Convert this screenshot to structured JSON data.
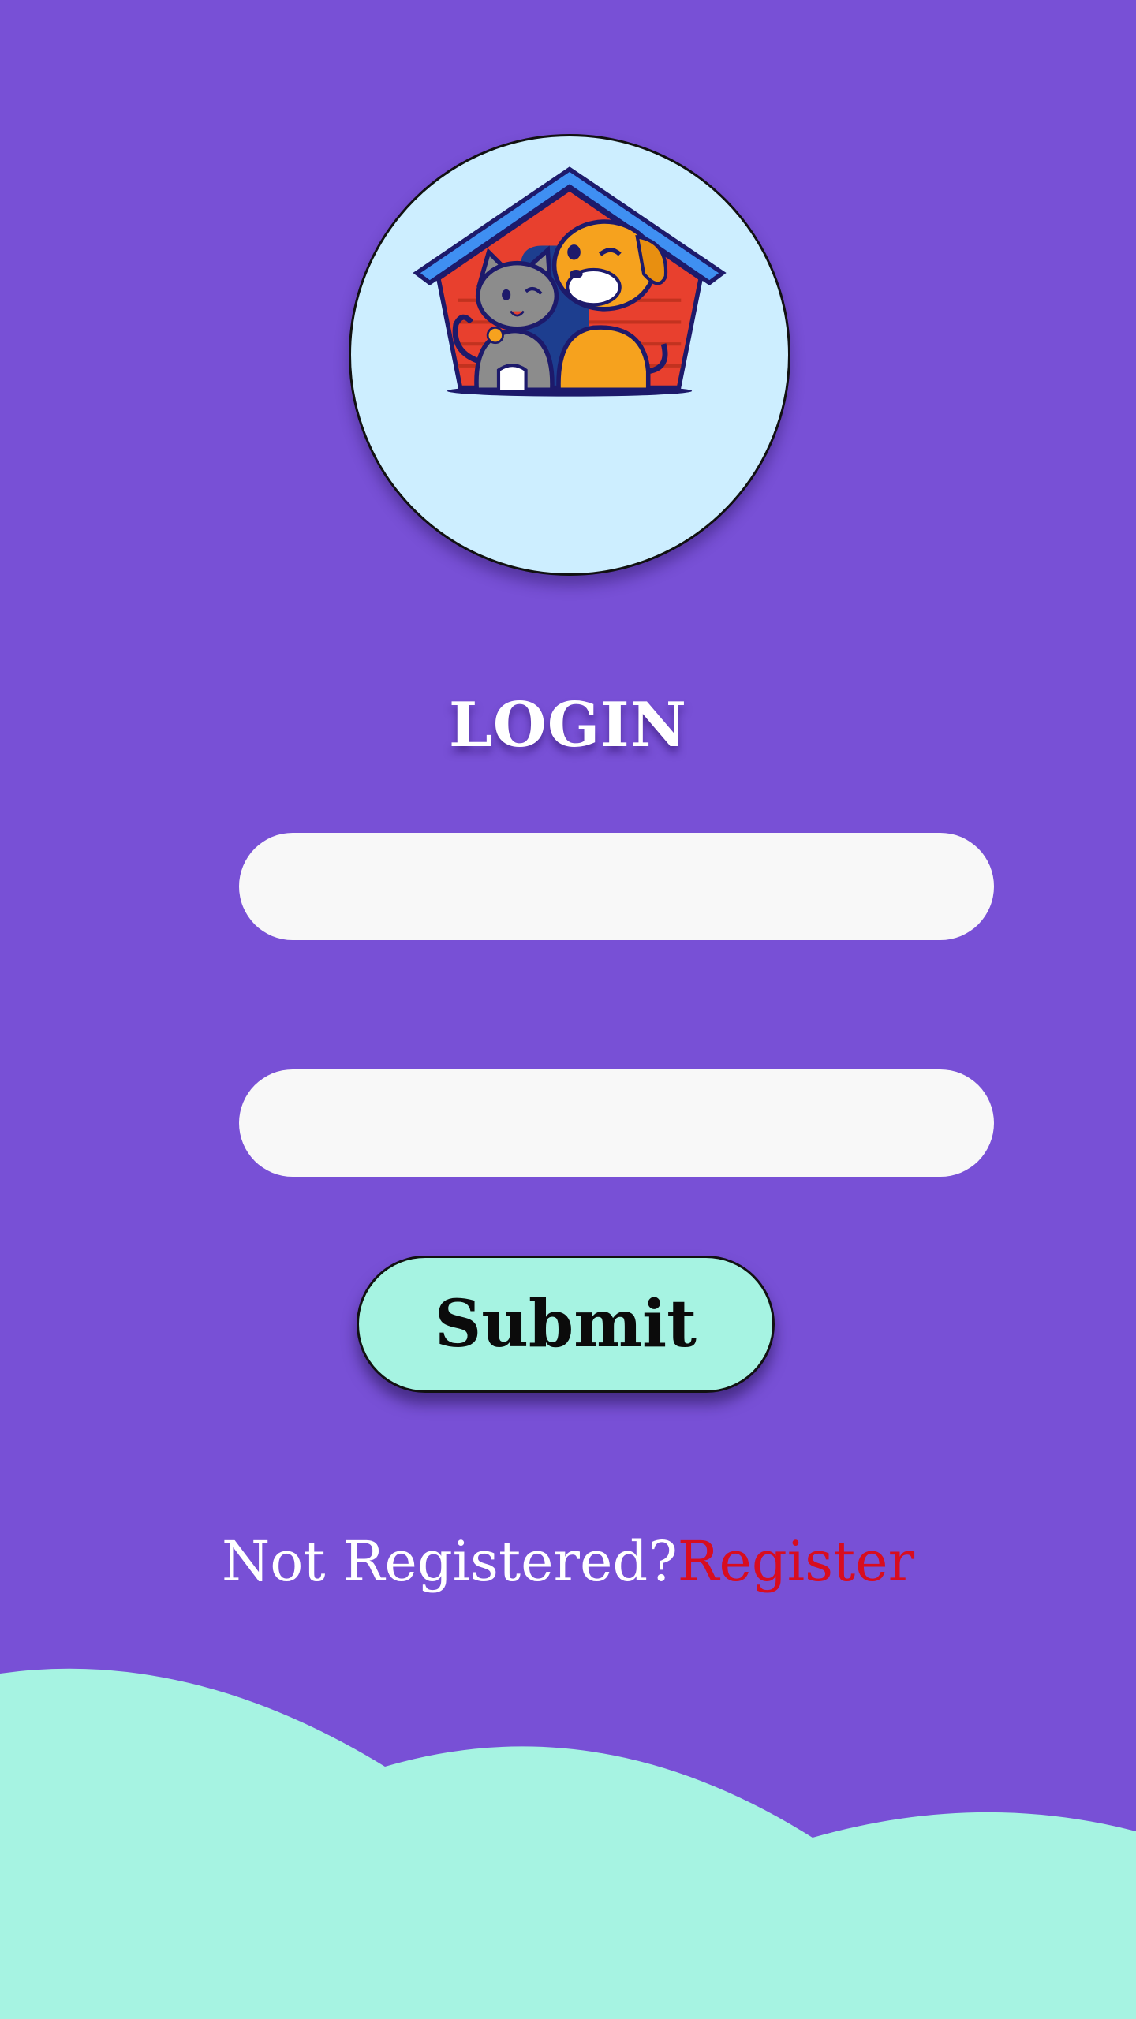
{
  "colors": {
    "background": "#7850d6",
    "accent": "#a6f3e2",
    "field_background": "#f8f8f8",
    "link": "#d80d1f",
    "logo_background": "#cdeeff"
  },
  "logo": {
    "icon": "cat-and-dog-house-icon"
  },
  "login": {
    "title": "LOGIN",
    "username_placeholder": "",
    "password_placeholder": "",
    "submit_label": "Submit"
  },
  "register": {
    "prompt": "Not Registered?",
    "link_label": "Register"
  },
  "footer": {
    "decoration": "wave-hills"
  }
}
